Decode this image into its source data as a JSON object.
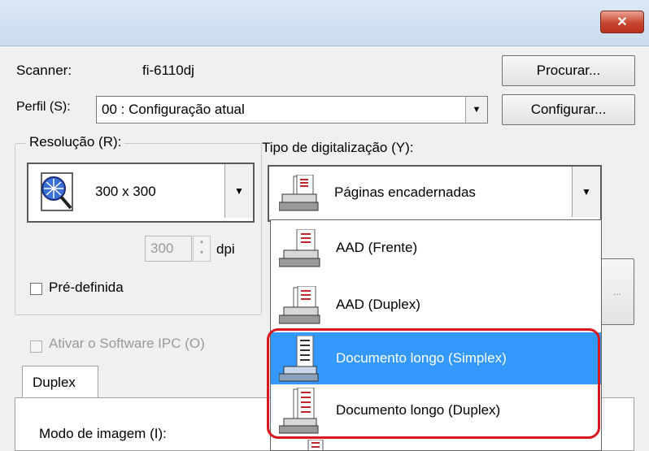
{
  "window": {
    "close_label": "✕"
  },
  "scanner": {
    "label": "Scanner:",
    "value": "fi-6110dj",
    "browse_button": "Procurar..."
  },
  "profile": {
    "label": "Perfil (S):",
    "value": "00 : Configuração atual",
    "configure_button": "Configurar..."
  },
  "resolution": {
    "group_label": "Resolução (R):",
    "value": "300 x 300",
    "spin_value": "300",
    "unit": "dpi",
    "predefined_label": "Pré-definida"
  },
  "scan_type": {
    "label": "Tipo de digitalização (Y):",
    "selected": "Páginas encadernadas",
    "options": [
      "AAD (Frente)",
      "AAD (Duplex)",
      "Documento longo (Simplex)",
      "Documento longo (Duplex)"
    ],
    "highlighted_option": "Documento longo (Simplex)"
  },
  "ipc": {
    "label": "Ativar o Software IPC (O)"
  },
  "tabs": {
    "duplex": "Duplex"
  },
  "image_mode": {
    "label": "Modo de imagem (I):"
  },
  "side_button": {
    "label": "..."
  },
  "colors": {
    "selection": "#3399ff",
    "highlight_border": "#d7191f",
    "titlebar": "#c9dbee"
  }
}
